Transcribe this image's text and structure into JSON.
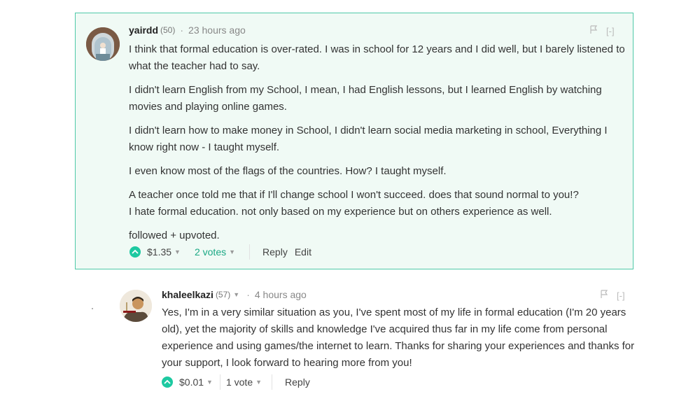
{
  "main_comment": {
    "author": "yairdd",
    "reputation": "(50)",
    "separator": "·",
    "time": "23 hours ago",
    "flag_label": "[-]",
    "paragraphs": [
      "I think that formal education is over-rated. I was in school for 12 years and I did well, but I barely listened to what the teacher had to say.",
      "I didn't learn English from my School, I mean, I had English lessons, but I learned English by watching movies and playing online games.",
      "I didn't learn how to make money in School, I didn't learn social media marketing in school, Everything I know right now - I taught myself.",
      "I even know most of the flags of the countries. How? I taught myself.",
      "A teacher once told me that if I'll change school I won't succeed. does that sound normal to you!?",
      "I hate formal education. not only based on my experience but on others experience as well.",
      "followed + upvoted."
    ],
    "payout": "$1.35",
    "votes": "2 votes",
    "reply_label": "Reply",
    "edit_label": "Edit"
  },
  "reply_comment": {
    "author": "khaleelkazi",
    "reputation": "(57)",
    "separator": "·",
    "time": "4 hours ago",
    "flag_label": "[-]",
    "text": "Yes, I'm in a very similar situation as you, I've spent most of my life in formal education (I'm 20 years old), yet the majority of skills and knowledge I've acquired thus far in my life come from personal experience and using games/the internet to learn. Thanks for sharing your experiences and thanks for your support, I look forward to hearing more from you!",
    "payout": "$0.01",
    "votes": "1 vote",
    "reply_label": "Reply"
  },
  "colors": {
    "accent": "#1dc9a1",
    "highlight_bg": "#f0faf5",
    "highlight_border": "#4fc9a8"
  },
  "icons": [
    "flag-icon",
    "upvote-icon",
    "caret-down-icon"
  ]
}
